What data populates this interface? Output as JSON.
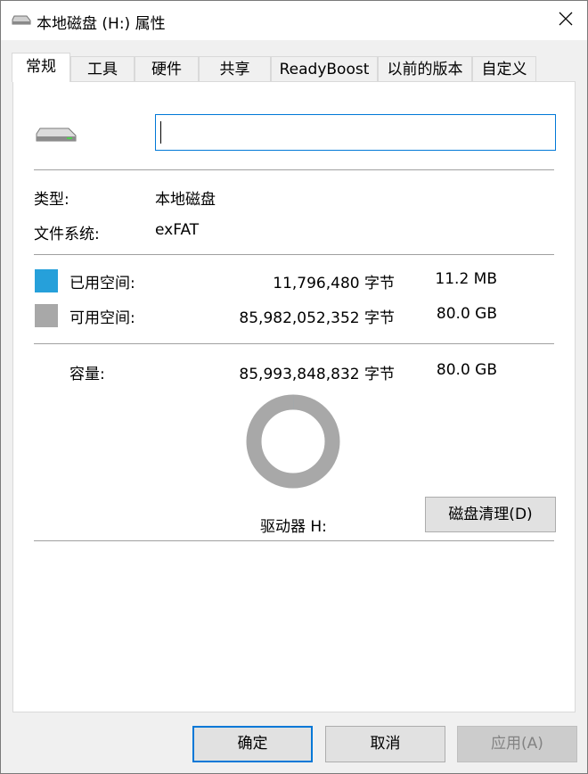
{
  "window": {
    "title": "本地磁盘 (H:) 属性"
  },
  "tabs": [
    {
      "label": "常规",
      "active": true
    },
    {
      "label": "工具"
    },
    {
      "label": "硬件"
    },
    {
      "label": "共享"
    },
    {
      "label": "ReadyBoost"
    },
    {
      "label": "以前的版本"
    },
    {
      "label": "自定义"
    }
  ],
  "general": {
    "name_value": "",
    "type_label": "类型:",
    "type_value": "本地磁盘",
    "fs_label": "文件系统:",
    "fs_value": "exFAT",
    "used_label": "已用空间:",
    "used_bytes": "11,796,480 字节",
    "used_size": "11.2 MB",
    "free_label": "可用空间:",
    "free_bytes": "85,982,052,352 字节",
    "free_size": "80.0 GB",
    "capacity_label": "容量:",
    "capacity_bytes": "85,993,848,832 字节",
    "capacity_size": "80.0 GB",
    "drive_label": "驱动器 H:",
    "cleanup_button": "磁盘清理(D)",
    "used_fraction": 0.000137
  },
  "colors": {
    "used": "#26a0da",
    "free": "#a8a8a8",
    "accent": "#0078d7"
  },
  "footer": {
    "ok": "确定",
    "cancel": "取消",
    "apply": "应用(A)"
  },
  "icons": {
    "title": "drive-icon",
    "close": "close-icon",
    "drive": "drive-icon"
  }
}
